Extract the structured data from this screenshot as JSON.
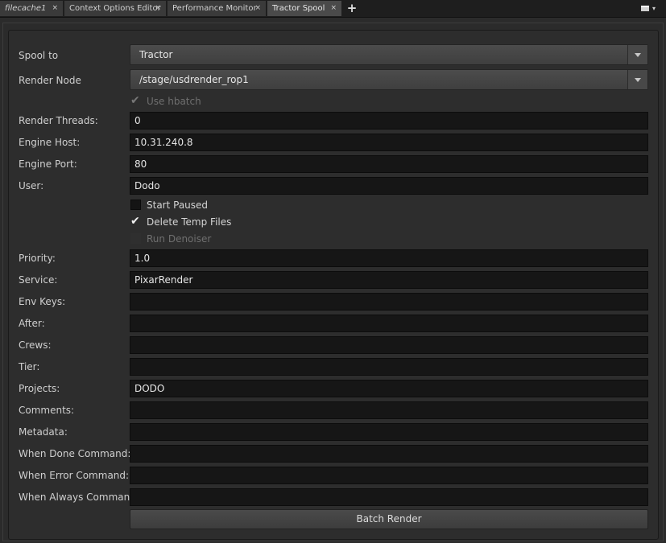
{
  "tabs": [
    {
      "label": "filecache1",
      "close": "×"
    },
    {
      "label": "Context Options Editor",
      "close": "×"
    },
    {
      "label": "Performance Monitor",
      "close": "×"
    },
    {
      "label": "Tractor Spool",
      "close": "×"
    }
  ],
  "add_tab": "+",
  "pane_menu_icon": "▾",
  "spool_to": {
    "label": "Spool to",
    "value": "Tractor"
  },
  "render_node": {
    "label": "Render Node",
    "value": "/stage/usdrender_rop1"
  },
  "use_hbatch": {
    "label": "Use hbatch",
    "checked": true,
    "enabled": false
  },
  "fields": {
    "render_threads": {
      "label": "Render Threads:",
      "value": "0"
    },
    "engine_host": {
      "label": "Engine Host:",
      "value": "10.31.240.8"
    },
    "engine_port": {
      "label": "Engine Port:",
      "value": "80"
    },
    "user": {
      "label": "User:",
      "value": "Dodo"
    },
    "priority": {
      "label": "Priority:",
      "value": "1.0"
    },
    "service": {
      "label": "Service:",
      "value": "PixarRender"
    },
    "env_keys": {
      "label": "Env Keys:",
      "value": ""
    },
    "after": {
      "label": "After:",
      "value": ""
    },
    "crews": {
      "label": "Crews:",
      "value": ""
    },
    "tier": {
      "label": "Tier:",
      "value": ""
    },
    "projects": {
      "label": "Projects:",
      "value": "DODO"
    },
    "comments": {
      "label": "Comments:",
      "value": ""
    },
    "metadata": {
      "label": "Metadata:",
      "value": ""
    },
    "when_done": {
      "label": "When Done Command:",
      "value": ""
    },
    "when_error": {
      "label": "When Error Command:",
      "value": ""
    },
    "when_always": {
      "label": "When Always Command:",
      "value": ""
    }
  },
  "checkboxes": {
    "start_paused": {
      "label": "Start Paused",
      "checked": false,
      "enabled": true
    },
    "delete_temp": {
      "label": "Delete Temp Files",
      "checked": true,
      "enabled": true
    },
    "run_denoiser": {
      "label": "Run Denoiser",
      "checked": false,
      "enabled": false
    }
  },
  "check_glyph": "✔",
  "batch_render_label": "Batch Render"
}
